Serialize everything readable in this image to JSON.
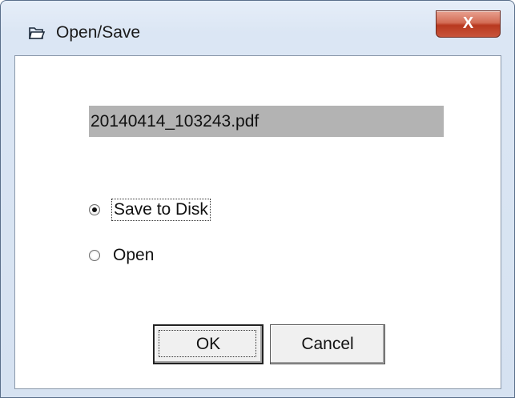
{
  "window": {
    "title": "Open/Save",
    "close_glyph": "X"
  },
  "file": {
    "name": "20140414_103243.pdf"
  },
  "options": {
    "save_label": "Save to Disk",
    "open_label": "Open",
    "selected": "save"
  },
  "buttons": {
    "ok_label": "OK",
    "cancel_label": "Cancel"
  },
  "icons": {
    "app": "folder-icon",
    "close": "close-icon"
  }
}
